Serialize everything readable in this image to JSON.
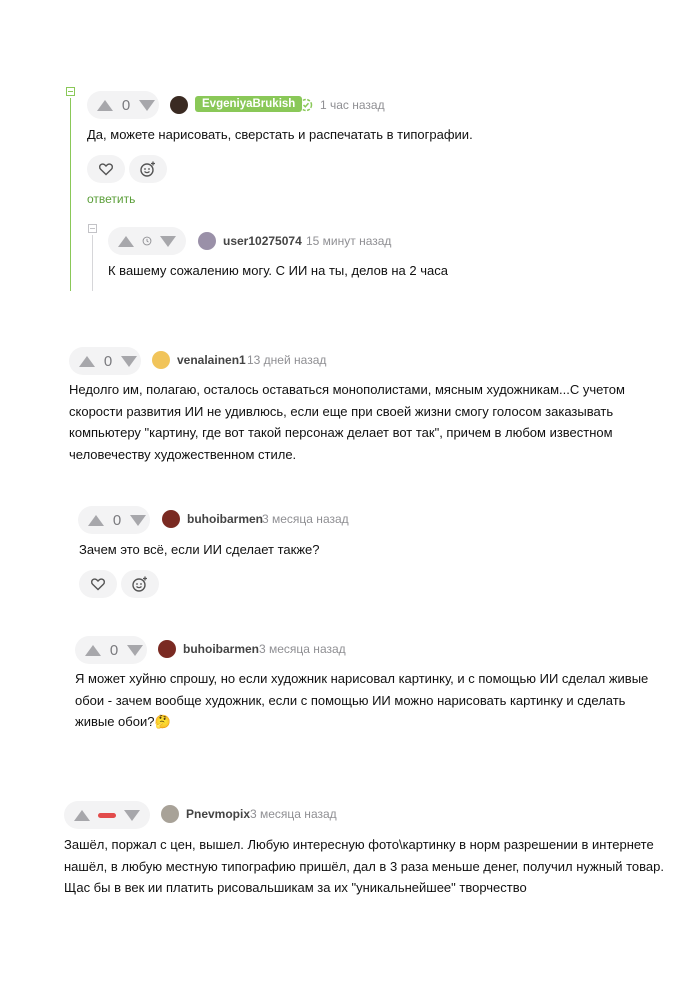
{
  "comments": [
    {
      "score": "0",
      "username": "EvgeniyaBrukish",
      "time": "1 час назад",
      "text": "Да, можете нарисовать, сверстать и распечатать в типографии.",
      "reply_label": "ответить",
      "avatar_color": "#3a2a22"
    },
    {
      "username": "user10275074",
      "time": "15 минут назад",
      "text": "К вашему сожалению могу. С ИИ на ты, делов на 2 часа",
      "avatar_color": "#9a90a8"
    },
    {
      "score": "0",
      "username": "venalainen1",
      "time": "13 дней назад",
      "text": [
        "Недолго им, полагаю, осталось оставаться монополистами, мясным художникам...С учетом",
        "скорости развития ИИ не удивлюсь, если еще при своей жизни смогу голосом заказывать",
        "компьютеру \"картину, где вот такой персонаж делает вот так\", причем в любом известном",
        "человечеству художественном стиле."
      ],
      "avatar_color": "#f1c45a"
    },
    {
      "score": "0",
      "username": "buhoibarmen",
      "time": "3 месяца назад",
      "text": "Зачем это всё, если ИИ сделает также?",
      "avatar_color": "#7a2a22"
    },
    {
      "score": "0",
      "username": "buhoibarmen",
      "time": "3 месяца назад",
      "text": [
        "Я может хуйню спрошу, но если художник нарисовал картинку, и с помощью ИИ сделал живые",
        "обои - зачем вообще художник, если с помощью ИИ можно нарисовать картинку и сделать",
        "живые обои?🤔"
      ],
      "avatar_color": "#7a2a22"
    },
    {
      "username": "Pnevmopix",
      "time": "3 месяца назад",
      "text": [
        "Зашёл, поржал с цен, вышел. Любую интересную фото\\картинку в норм разрешении в интернете",
        "нашёл, в любую местную типографию пришёл, дал в 3 раза меньше денег, получил нужный товар.",
        "Щас бы в век ии платить рисовальшикам за их \"уникальнейшее\" творчество"
      ],
      "avatar_color": "#a8a298"
    }
  ],
  "icons": {
    "upvote": "triangle-up",
    "downvote": "triangle-down",
    "like": "heart",
    "react": "smiley-plus",
    "pending": "clock",
    "verified": "verified-badge"
  },
  "colors": {
    "accent_green": "#8ac858",
    "negative_red": "#e24b4b",
    "muted": "#8f8f93"
  }
}
